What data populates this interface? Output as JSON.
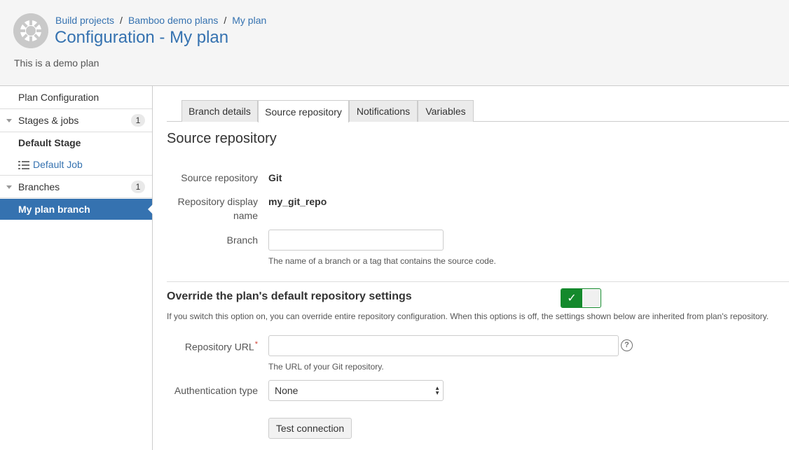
{
  "header": {
    "breadcrumbs": [
      "Build projects",
      "Bamboo demo plans",
      "My plan"
    ],
    "title": "Configuration - My plan",
    "description": "This is a demo plan"
  },
  "sidebar": {
    "plan_configuration": "Plan Configuration",
    "stages_jobs": {
      "label": "Stages & jobs",
      "count": "1"
    },
    "default_stage": "Default Stage",
    "default_job": "Default Job",
    "branches": {
      "label": "Branches",
      "count": "1"
    },
    "active_branch": "My plan branch"
  },
  "tabs": [
    {
      "label": "Branch details"
    },
    {
      "label": "Source repository",
      "active": true
    },
    {
      "label": "Notifications"
    },
    {
      "label": "Variables"
    }
  ],
  "main": {
    "section_title": "Source repository",
    "source_repository": {
      "label": "Source repository",
      "value": "Git"
    },
    "display_name": {
      "label": "Repository display name",
      "value": "my_git_repo"
    },
    "branch": {
      "label": "Branch",
      "value": "",
      "hint": "The name of a branch or a tag that contains the source code."
    },
    "override": {
      "title": "Override the plan's default repository settings",
      "enabled": true,
      "description": "If you switch this option on, you can override entire repository configuration. When this options is off, the settings shown below are inherited from plan's repository."
    },
    "repository_url": {
      "label": "Repository URL",
      "required_mark": "*",
      "value": "",
      "hint": "The URL of your Git repository.",
      "help": "?"
    },
    "auth_type": {
      "label": "Authentication type",
      "selected": "None"
    },
    "test_button": "Test connection"
  },
  "colors": {
    "link": "#3572b0",
    "active_bg": "#3572b0",
    "toggle_on": "#14892c",
    "required": "#d04437"
  },
  "icons": {
    "toggle_check": "✓",
    "select_arrows": "▲▼"
  }
}
